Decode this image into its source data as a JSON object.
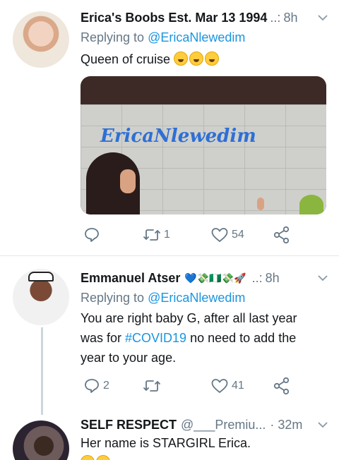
{
  "tweets": [
    {
      "display_name": "Erica's Boobs Est. Mar 13 1994",
      "dots": "..:",
      "time": "8h",
      "reply_prefix": "Replying to",
      "reply_handle": "@EricaNlewedim",
      "text": "Queen of cruise",
      "emojis": [
        "rolling-on-floor-laughing",
        "rolling-on-floor-laughing",
        "rolling-on-floor-laughing"
      ],
      "media_caption": "EricaNlewedim",
      "actions": {
        "reply_count": "",
        "retweet_count": "1",
        "like_count": "54"
      }
    },
    {
      "display_name": "Emmanuel Atser",
      "name_emojis": "💙💸🇳🇬💸🚀",
      "dots": "..:",
      "time": "8h",
      "reply_prefix": "Replying to",
      "reply_handle": "@EricaNlewedim",
      "text_before": "You are right baby G, after all last year was for ",
      "hashtag": "#COVID19",
      "text_after": " no need to add the year to your age.",
      "actions": {
        "reply_count": "2",
        "retweet_count": "",
        "like_count": "41"
      }
    },
    {
      "display_name": "SELF RESPECT",
      "handle": "@___Premiu...",
      "time": "· 32m",
      "text": "Her name is STARGIRL Erica.",
      "emojis": [
        "grinning-face",
        "grinning-face"
      ]
    }
  ],
  "colors": {
    "link": "#1b95e0",
    "secondary": "#657786",
    "primary": "#14171a",
    "divider": "#e1e8ed"
  },
  "icons": [
    "reply-icon",
    "retweet-icon",
    "like-icon",
    "share-icon",
    "chevron-down-icon"
  ]
}
